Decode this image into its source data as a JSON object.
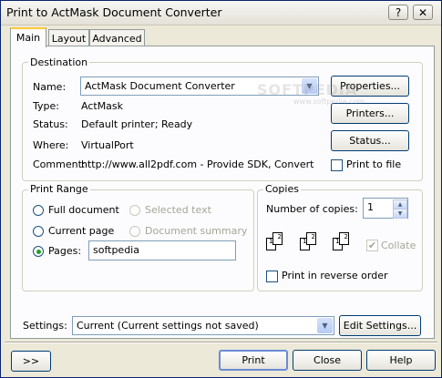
{
  "window": {
    "title": "Print to ActMask Document Converter"
  },
  "titlebar_buttons": {
    "help": "?",
    "close": "✕"
  },
  "tabs": [
    {
      "label": "Main"
    },
    {
      "label": "Layout"
    },
    {
      "label": "Advanced"
    }
  ],
  "destination": {
    "legend": "Destination",
    "name_label": "Name:",
    "name_value": "ActMask Document Converter",
    "type_label": "Type:",
    "type_value": "ActMask",
    "status_label": "Status:",
    "status_value": "Default printer; Ready",
    "where_label": "Where:",
    "where_value": "VirtualPort",
    "comment_label": "Comment:",
    "comment_value": "http://www.all2pdf.com - Provide SDK, Convert",
    "properties_button": "Properties...",
    "printers_button": "Printers...",
    "status_button": "Status...",
    "print_to_file": "Print to file"
  },
  "print_range": {
    "legend": "Print Range",
    "full_document": "Full document",
    "selected_text": "Selected text",
    "current_page": "Current page",
    "document_summary": "Document summary",
    "pages": "Pages:",
    "pages_value": "softpedia"
  },
  "copies": {
    "legend": "Copies",
    "number_label": "Number of copies:",
    "number_value": "1",
    "collate": "Collate",
    "reverse": "Print in reverse order",
    "page_numbers": [
      "1",
      "2"
    ]
  },
  "settings": {
    "label": "Settings:",
    "value": "Current (Current settings not saved)",
    "edit_button": "Edit Settings..."
  },
  "footer": {
    "expand": ">>",
    "print": "Print",
    "close": "Close",
    "help": "Help"
  },
  "watermark": {
    "line1": "SOFTPEDIA",
    "line2": "www.softpedia.com"
  }
}
